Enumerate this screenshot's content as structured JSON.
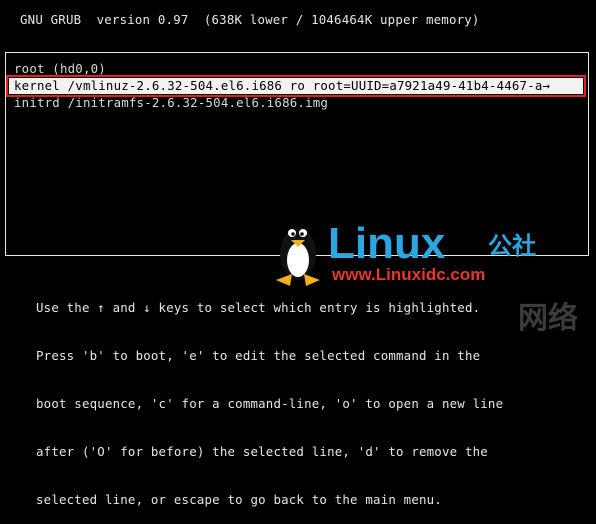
{
  "header": "GNU GRUB  version 0.97  (638K lower / 1046464K upper memory)",
  "menu": {
    "entries": [
      {
        "text": "root (hd0,0)",
        "selected": false
      },
      {
        "text": "kernel /vmlinuz-2.6.32-504.el6.i686 ro root=UUID=a7921a49-41b4-4467-a→",
        "selected": true
      },
      {
        "text": "initrd /initramfs-2.6.32-504.el6.i686.img",
        "selected": false
      }
    ]
  },
  "help_lines": [
    "Use the ↑ and ↓ keys to select which entry is highlighted.",
    "Press 'b' to boot, 'e' to edit the selected command in the",
    "boot sequence, 'c' for a command-line, 'o' to open a new line",
    "after ('O' for before) the selected line, 'd' to remove the",
    "selected line, or escape to go back to the main menu."
  ],
  "watermark": {
    "logo_text": "Linux",
    "cn_text": "公社",
    "url": "www.Linuxidc.com",
    "side_text": "网络",
    "colors": {
      "blue": "#2aa6e0",
      "red": "#e53a2a",
      "black": "#111111"
    }
  }
}
